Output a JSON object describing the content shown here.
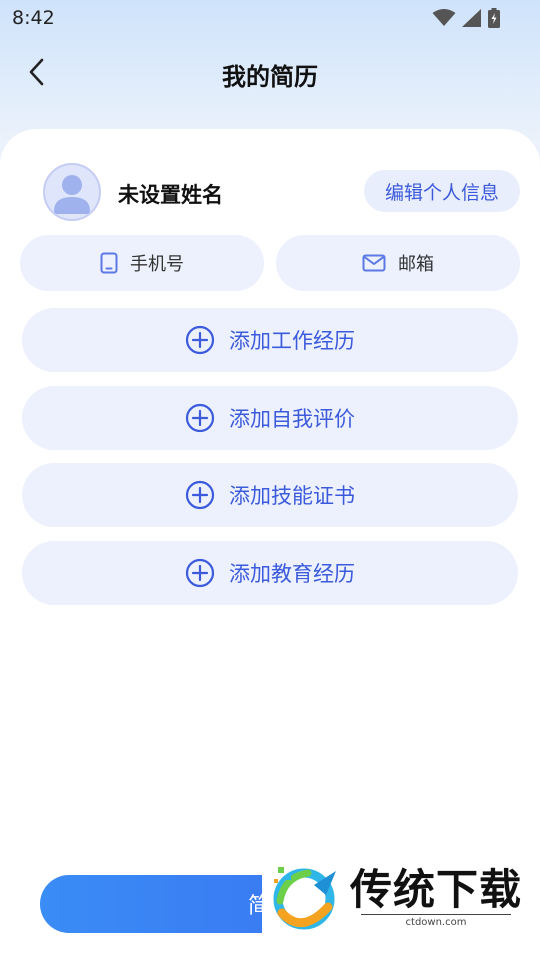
{
  "status_bar": {
    "time": "8:42"
  },
  "header": {
    "title": "我的简历",
    "back_icon": "chevron-left-icon"
  },
  "profile": {
    "name": "未设置姓名",
    "edit_label": "编辑个人信息",
    "avatar_icon": "user-avatar-icon"
  },
  "contacts": [
    {
      "label": "手机号",
      "icon": "phone-icon"
    },
    {
      "label": "邮箱",
      "icon": "mail-icon"
    }
  ],
  "sections": [
    {
      "label": "添加工作经历",
      "icon": "plus-circle-icon"
    },
    {
      "label": "添加自我评价",
      "icon": "plus-circle-icon"
    },
    {
      "label": "添加技能证书",
      "icon": "plus-circle-icon"
    },
    {
      "label": "添加教育经历",
      "icon": "plus-circle-icon"
    }
  ],
  "bottom_button": {
    "label": "简历"
  },
  "watermark": {
    "brand": "传统下载",
    "url": "ctdown.com"
  },
  "colors": {
    "accent": "#3c5bdc",
    "pill_bg": "#edf1fd",
    "button_start": "#3a8cf6",
    "button_end": "#3b6cf0"
  }
}
